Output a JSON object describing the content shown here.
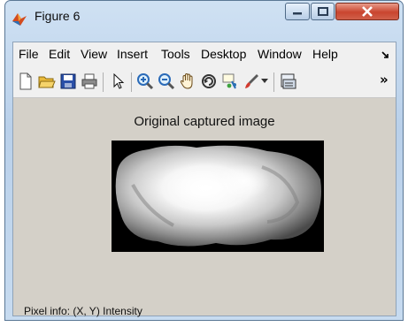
{
  "window": {
    "title": "Figure 6",
    "buttons": {
      "minimize": "minimize",
      "maximize": "maximize",
      "close": "close"
    }
  },
  "menubar": {
    "items": [
      "File",
      "Edit",
      "View",
      "Insert",
      "Tools",
      "Desktop",
      "Window",
      "Help"
    ],
    "overflow_icon": "dock-arrow-icon"
  },
  "toolbar": {
    "icons": [
      "new-figure-icon",
      "open-file-icon",
      "save-icon",
      "print-icon",
      "pointer-icon",
      "zoom-in-icon",
      "zoom-out-icon",
      "pan-hand-icon",
      "rotate-3d-icon",
      "data-cursor-icon",
      "brush-icon",
      "dropdown-arrow-icon",
      "link-plot-icon"
    ],
    "overflow": "»"
  },
  "figure": {
    "title": "Original captured image",
    "pixel_info": "Pixel info: (X, Y)  Intensity"
  },
  "colors": {
    "client_bg": "#d4d0c8",
    "close_button": "#c9452f",
    "title_bar": "#b9d0ea"
  }
}
